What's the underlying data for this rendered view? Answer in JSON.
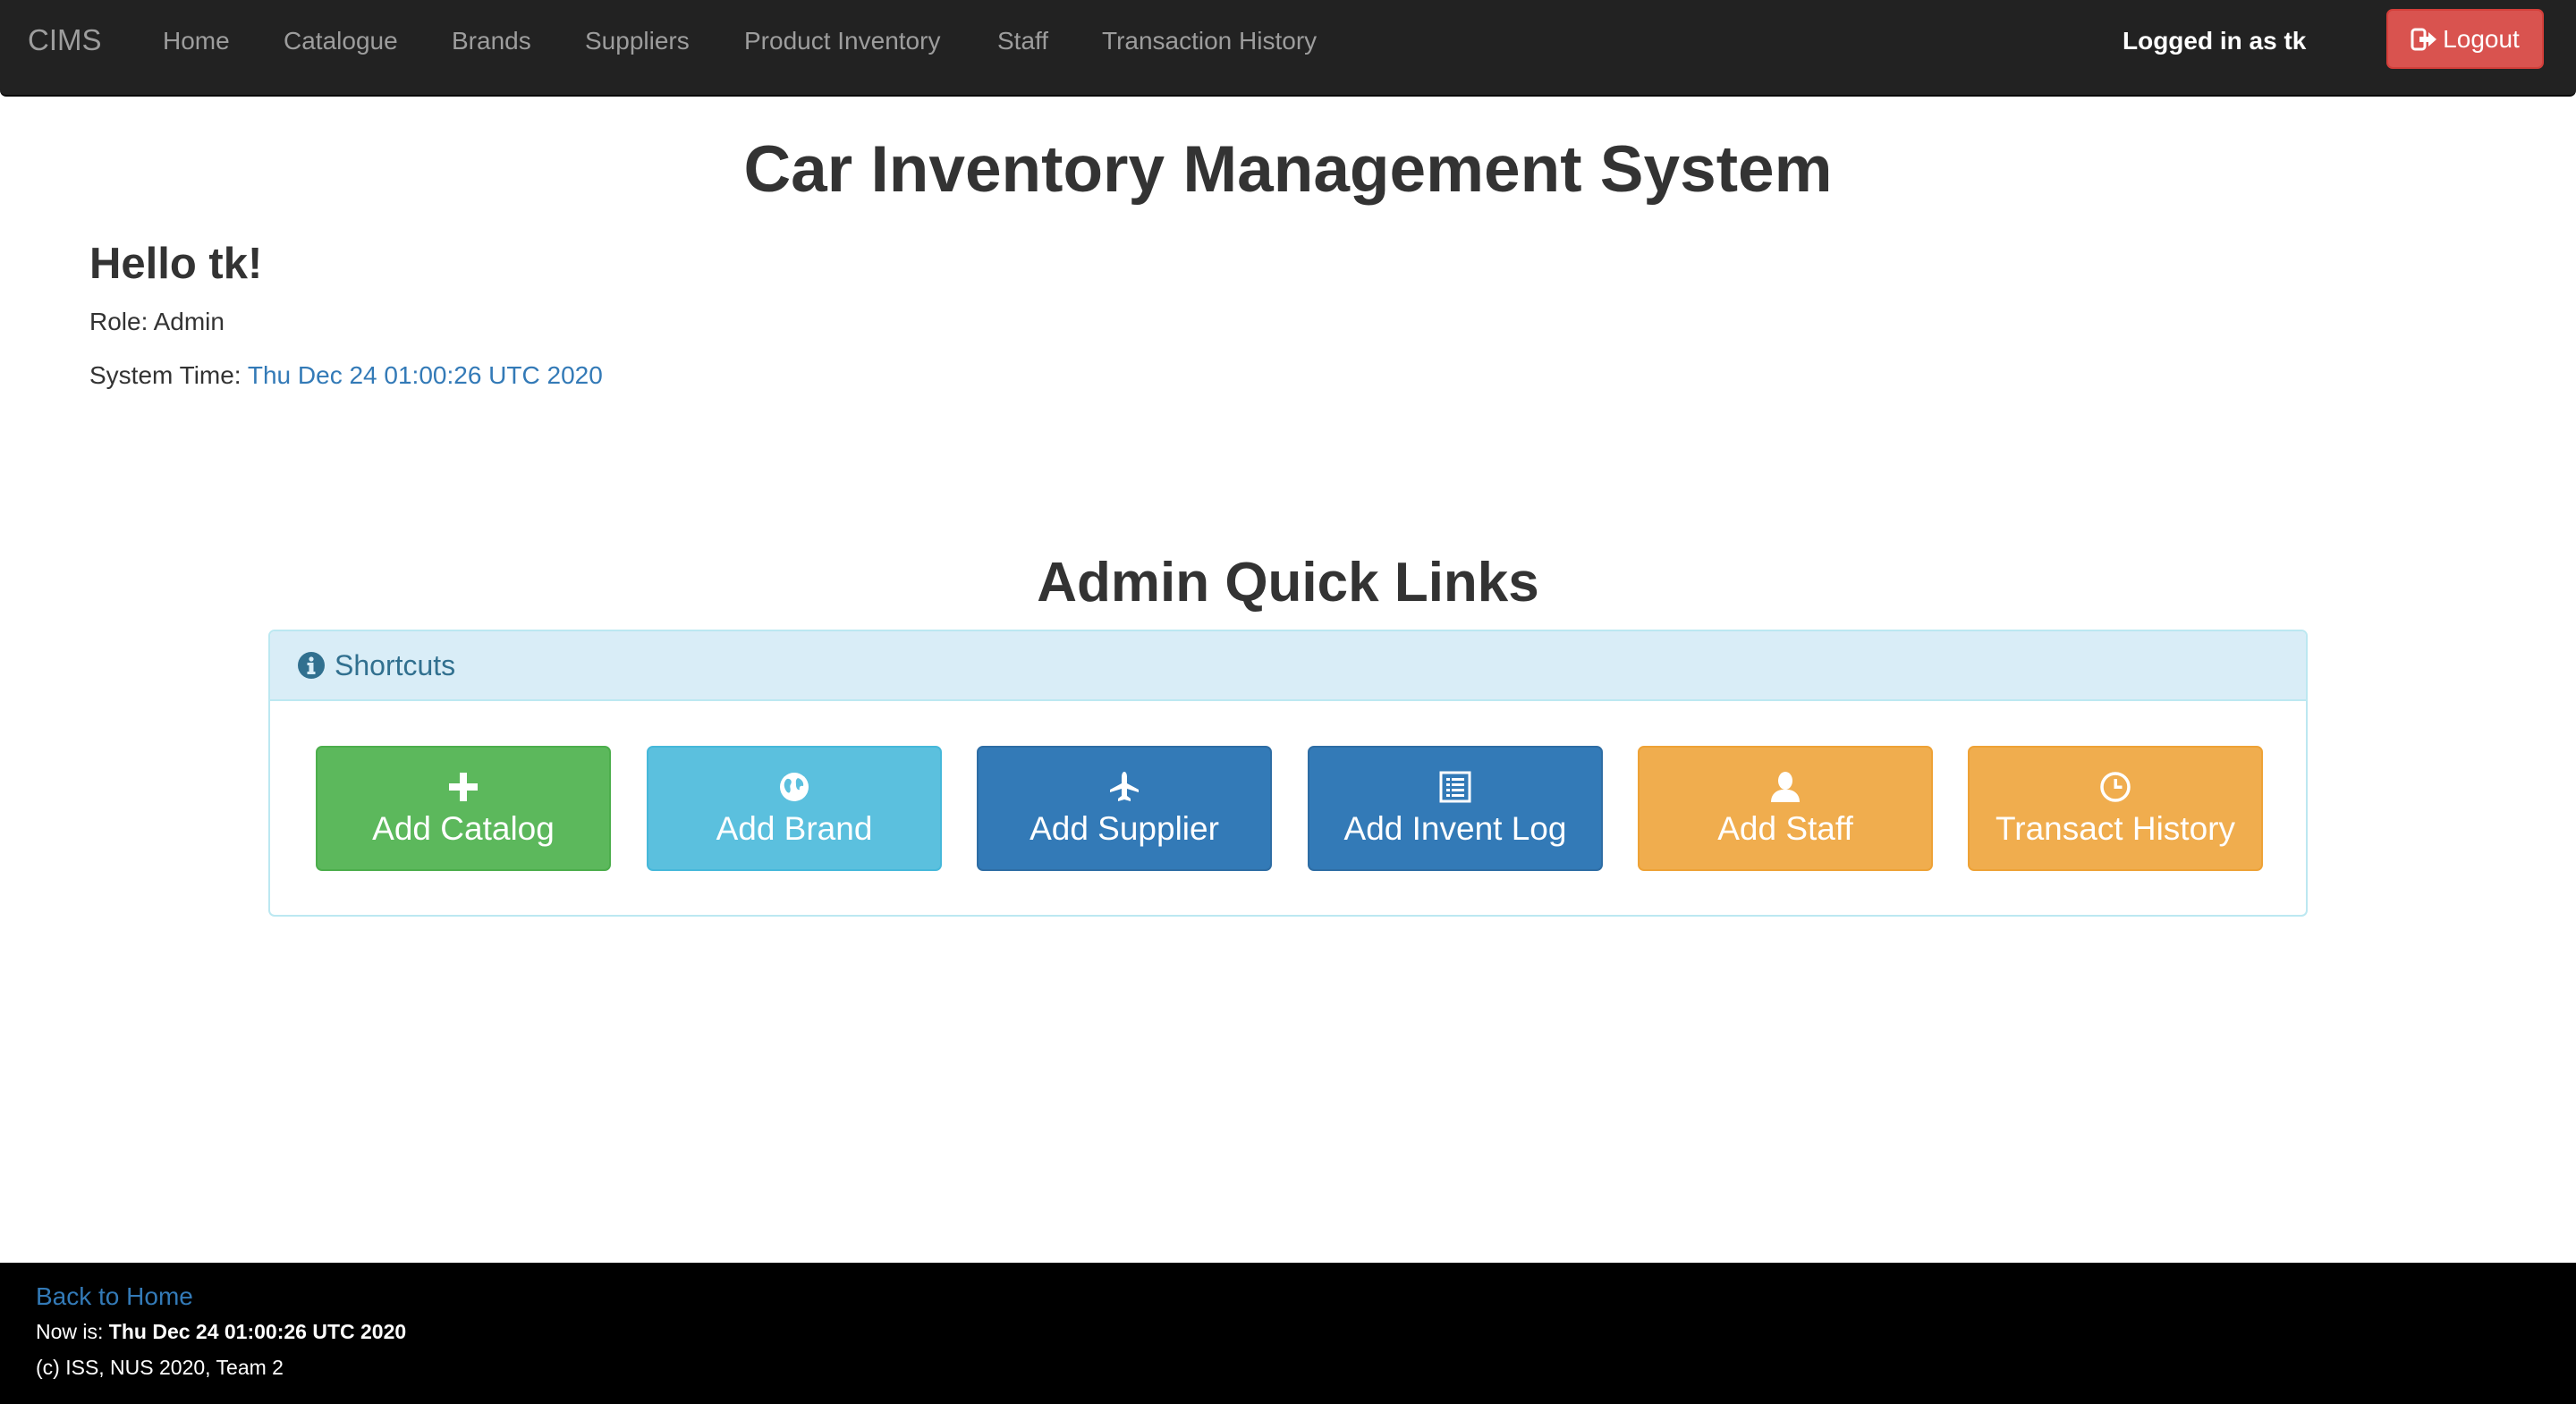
{
  "navbar": {
    "brand": "CIMS",
    "items": [
      {
        "label": "Home"
      },
      {
        "label": "Catalogue"
      },
      {
        "label": "Brands"
      },
      {
        "label": "Suppliers"
      },
      {
        "label": "Product Inventory"
      },
      {
        "label": "Staff"
      },
      {
        "label": "Transaction History"
      }
    ],
    "logged_in_text": "Logged in as tk",
    "logout_label": "Logout",
    "logout_icon": "logout-icon"
  },
  "main": {
    "title": "Car Inventory Management System",
    "greeting": "Hello tk!",
    "role_label": "Role:",
    "role_value": "Admin",
    "time_label": "System Time:",
    "time_value": "Thu Dec 24 01:00:26 UTC 2020",
    "quick_links_title": "Admin Quick Links"
  },
  "panel": {
    "heading": "Shortcuts",
    "heading_icon": "info-icon",
    "buttons": [
      {
        "label": "Add Catalog",
        "icon": "plus-icon",
        "color": "#5cb85c"
      },
      {
        "label": "Add Brand",
        "icon": "globe-icon",
        "color": "#5bc0de"
      },
      {
        "label": "Add Supplier",
        "icon": "plane-icon",
        "color": "#337ab7"
      },
      {
        "label": "Add Invent Log",
        "icon": "list-icon",
        "color": "#337ab7"
      },
      {
        "label": "Add Staff",
        "icon": "user-icon",
        "color": "#f0ad4e"
      },
      {
        "label": "Transact History",
        "icon": "clock-icon",
        "color": "#f0ad4e"
      }
    ]
  },
  "footer": {
    "back_link": "Back to Home",
    "now_label": "Now is:",
    "now_value": "Thu Dec 24 01:00:26 UTC 2020",
    "copyright": "(c) ISS, NUS 2020, Team 2"
  }
}
